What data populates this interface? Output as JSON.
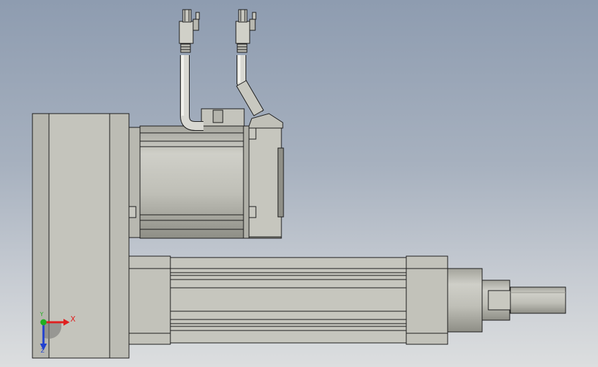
{
  "triad": {
    "x_label": "X",
    "y_label": "Y",
    "z_label": "Z"
  },
  "colors": {
    "background_top": "#8e9cb0",
    "background_bottom": "#dcdedf",
    "part_face": "#c2c2ba",
    "part_edge": "#1a1a1a",
    "axis_x": "#e02020",
    "axis_y": "#20b020",
    "axis_z": "#2040d0"
  }
}
